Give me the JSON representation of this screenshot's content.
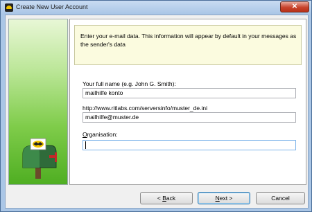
{
  "window": {
    "title": "Create New User Account",
    "close_label": "✕"
  },
  "info": {
    "text": "Enter your e-mail data. This information will appear by default in your messages as the sender's data"
  },
  "form": {
    "full_name_label": "Your full name (e.g. John G. Smith):",
    "full_name_value": "mailhilfe konto",
    "url_label": "http://www.ritlabs.com/serversinfo/muster_de.ini",
    "email_value": "mailhilfe@muster.de",
    "organisation_label_prefix": "O",
    "organisation_label_rest": "rganisation:",
    "organisation_value": ""
  },
  "buttons": {
    "back_arrow": "< ",
    "back_mnemonic": "B",
    "back_rest": "ack",
    "next_mnemonic": "N",
    "next_rest": "ext >",
    "cancel": "Cancel"
  },
  "icons": {
    "app": "bat-icon",
    "side": "mailbox-icon",
    "close": "close-icon"
  }
}
